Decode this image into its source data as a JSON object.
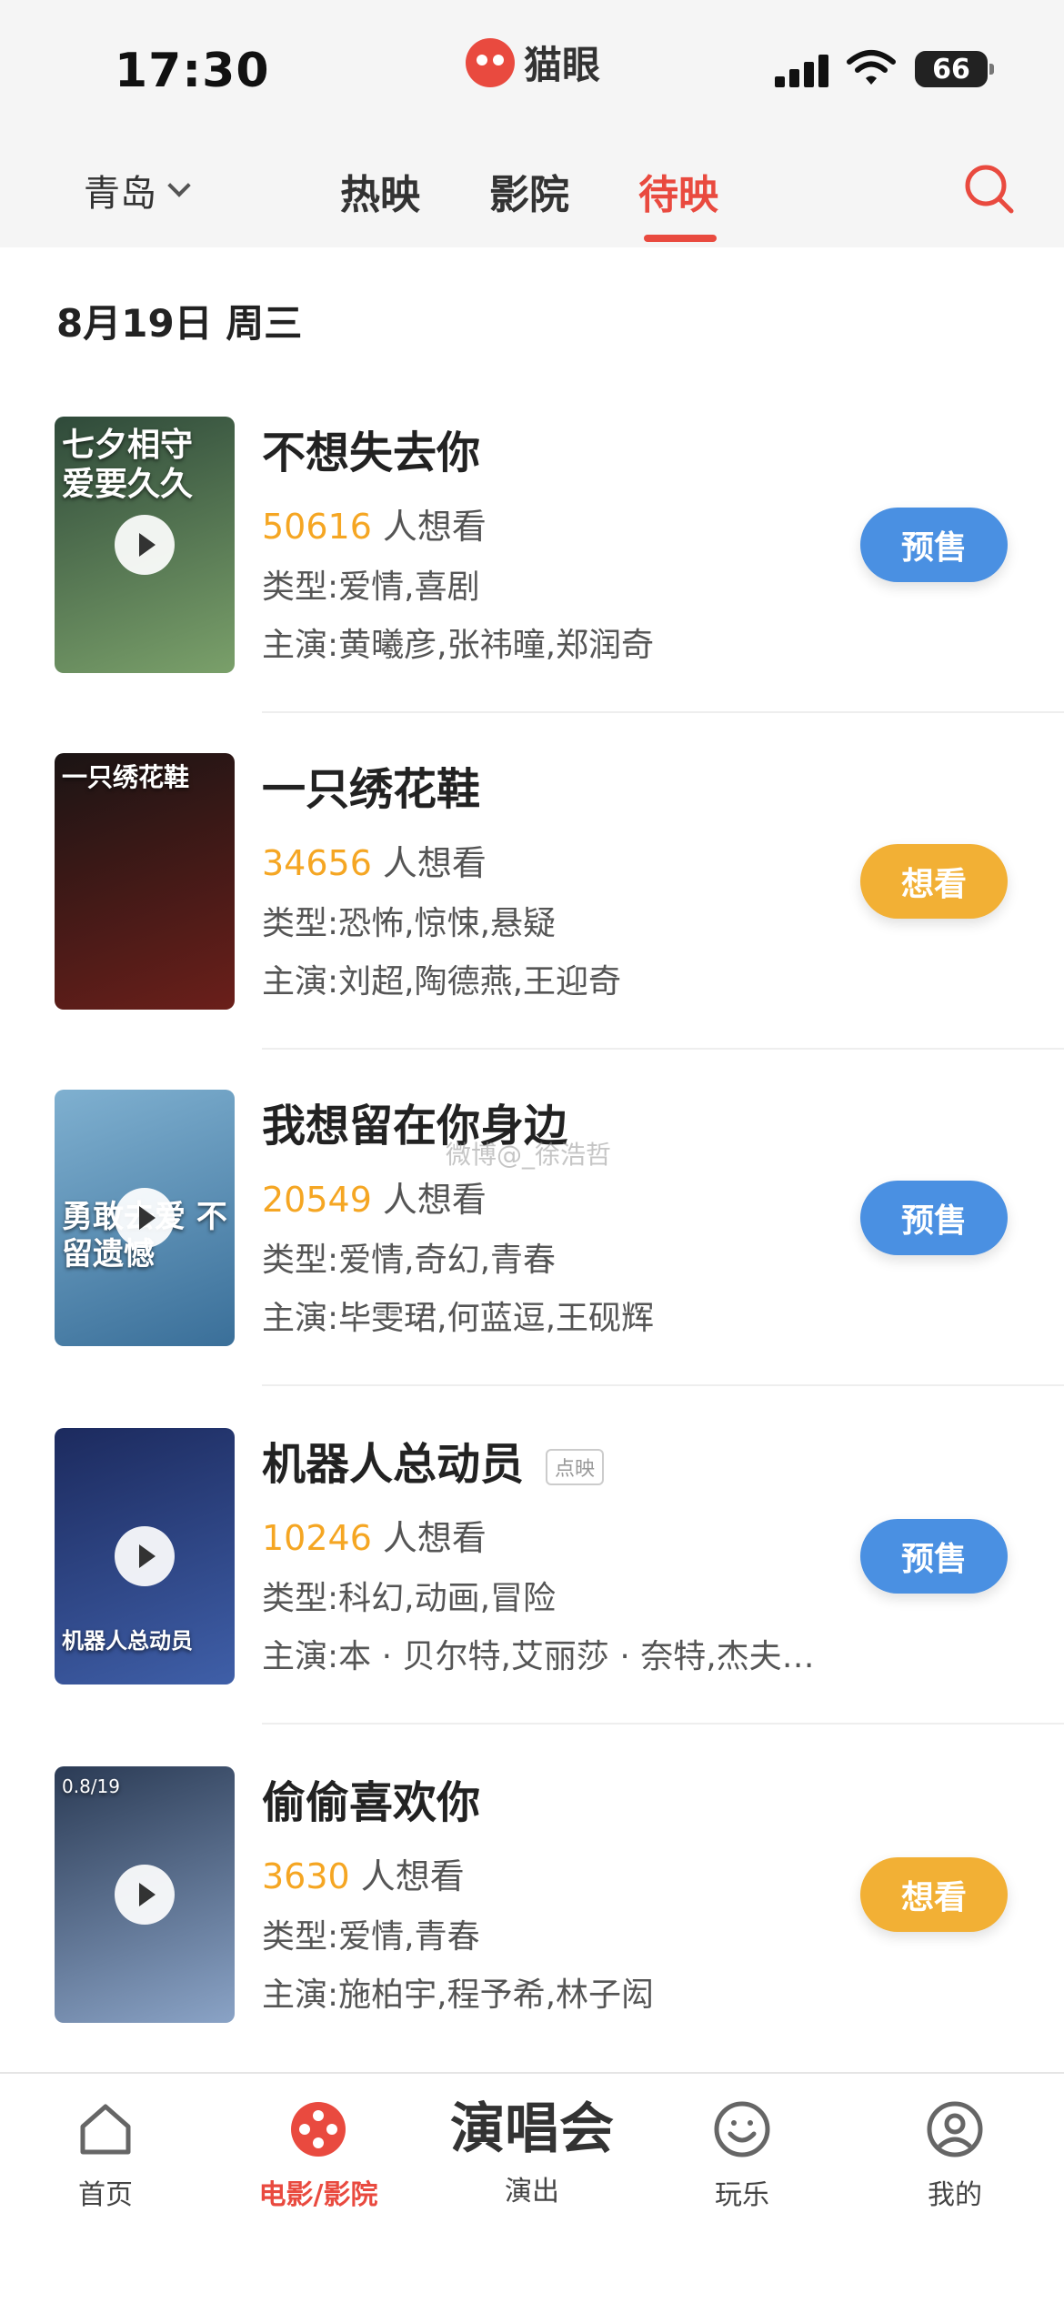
{
  "status": {
    "time": "17:30",
    "battery": "66",
    "brand": "猫眼"
  },
  "nav": {
    "city": "青岛",
    "tabs": [
      {
        "label": "热映"
      },
      {
        "label": "影院"
      },
      {
        "label": "待映"
      }
    ],
    "active_tab": "待映"
  },
  "date_header": "8月19日 周三",
  "movies": [
    {
      "title": "不想失去你",
      "want_count": "50616",
      "want_suffix": "人想看",
      "genre": "类型:爱情,喜剧",
      "cast": "主演:黄曦彦,张祎曈,郑润奇",
      "button": "预售",
      "poster_text": "七夕相守 爱要久久",
      "poster_colors": [
        "#2f4a3a",
        "#7aa06a"
      ]
    },
    {
      "title": "一只绣花鞋",
      "want_count": "34656",
      "want_suffix": "人想看",
      "genre": "类型:恐怖,惊悚,悬疑",
      "cast": "主演:刘超,陶德燕,王迎奇",
      "button": "想看",
      "poster_text": "一只绣花鞋",
      "poster_colors": [
        "#1a1414",
        "#6b1f1a"
      ]
    },
    {
      "title": "我想留在你身边",
      "want_count": "20549",
      "want_suffix": "人想看",
      "genre": "类型:爱情,奇幻,青春",
      "cast": "主演:毕雯珺,何蓝逗,王砚辉",
      "button": "预售",
      "poster_text": "勇敢去爱 不留遗憾",
      "poster_colors": [
        "#7fb0d0",
        "#3a6f99"
      ]
    },
    {
      "title": "机器人总动员",
      "tag": "点映",
      "want_count": "10246",
      "want_suffix": "人想看",
      "genre": "类型:科幻,动画,冒险",
      "cast": "主演:本 · 贝尔特,艾丽莎 · 奈特,杰夫…",
      "button": "预售",
      "poster_text": "机器人总动员",
      "poster_colors": [
        "#1c2a5e",
        "#3f5fa8"
      ]
    },
    {
      "title": "偷偷喜欢你",
      "want_count": "3630",
      "want_suffix": "人想看",
      "genre": "类型:爱情,青春",
      "cast": "主演:施柏宇,程予希,林子闳",
      "button": "想看",
      "poster_text": "0.8/19",
      "poster_colors": [
        "#2b3b55",
        "#8aa3c6"
      ]
    }
  ],
  "watermark": "微博@_徐浩哲",
  "tabbar": [
    {
      "label": "首页",
      "icon": "home-icon"
    },
    {
      "label": "电影/影院",
      "icon": "film-reel-icon"
    },
    {
      "label": "演出",
      "big": "演唱会"
    },
    {
      "label": "玩乐",
      "icon": "smile-icon"
    },
    {
      "label": "我的",
      "icon": "user-icon"
    }
  ],
  "colors": {
    "accent": "#e94a3f",
    "presale": "#4a90e2",
    "want": "#f2b035",
    "count": "#f5a623"
  }
}
